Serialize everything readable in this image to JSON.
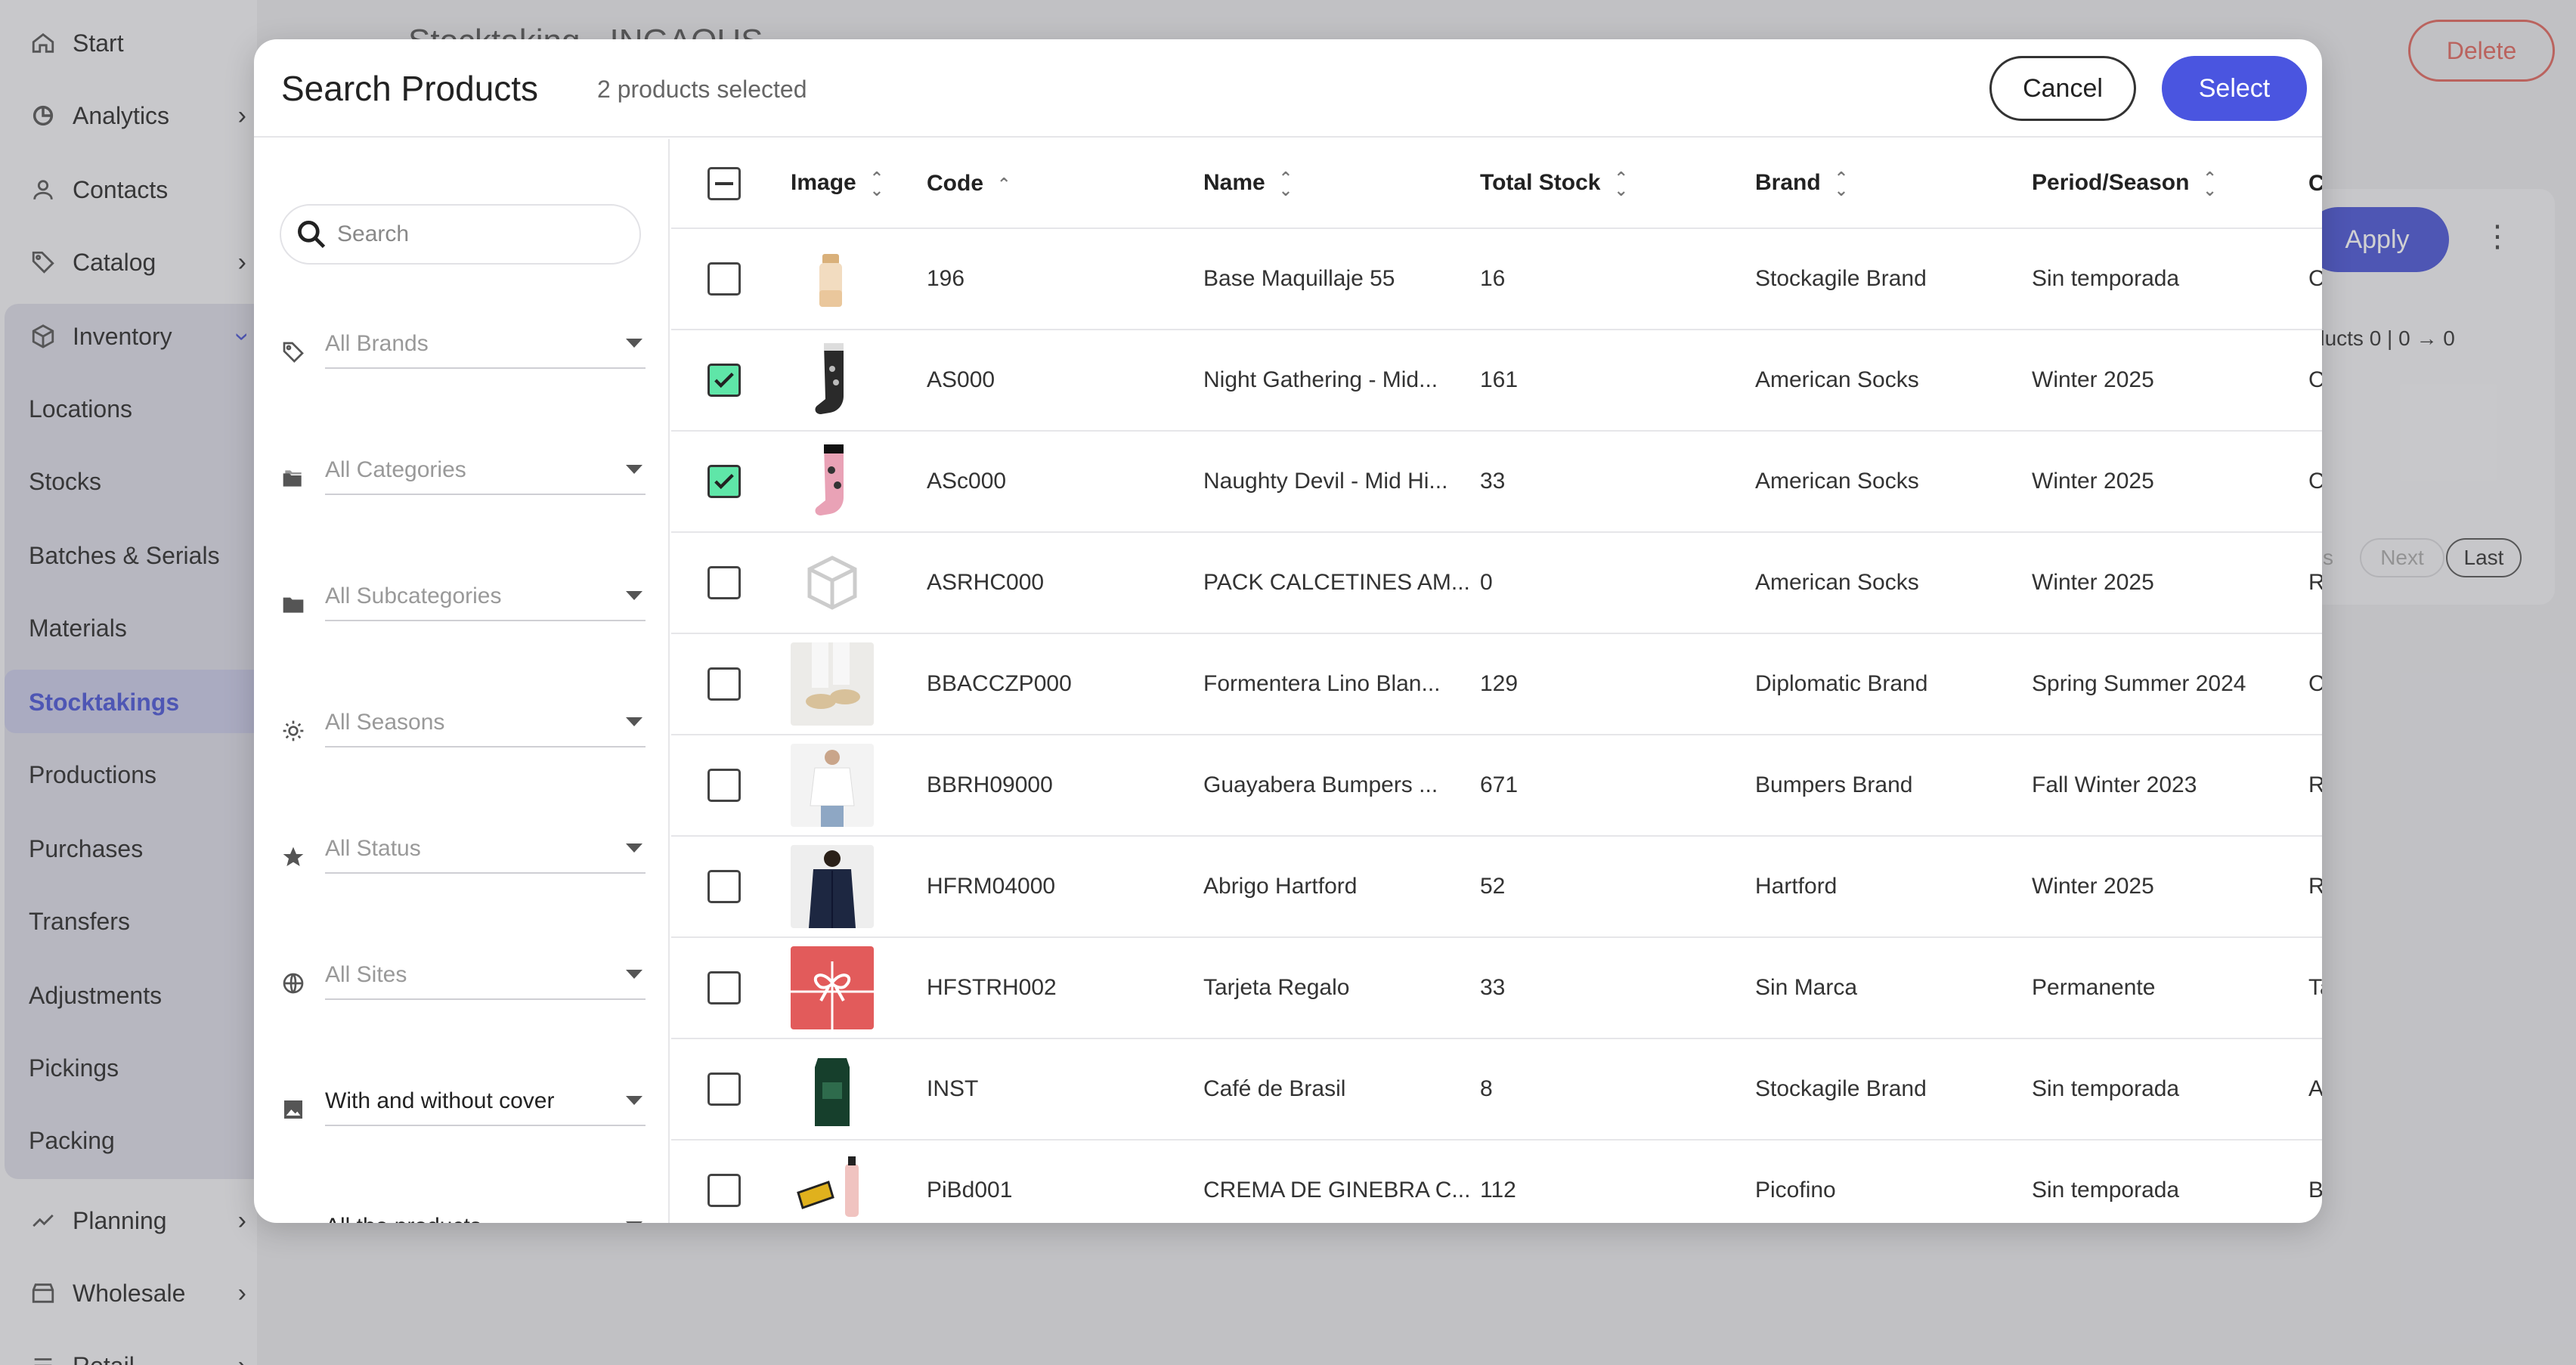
{
  "sidebar": {
    "items": [
      {
        "label": "Start",
        "icon": "home-icon",
        "chevron": false
      },
      {
        "label": "Analytics",
        "icon": "chart-icon",
        "chevron": true
      },
      {
        "label": "Contacts",
        "icon": "person-icon",
        "chevron": false
      },
      {
        "label": "Catalog",
        "icon": "tag-icon",
        "chevron": true
      },
      {
        "label": "Inventory",
        "icon": "box-icon",
        "chevron": true
      }
    ],
    "inventory_sub": [
      "Locations",
      "Stocks",
      "Batches & Serials",
      "Materials",
      "Stocktakings",
      "Productions",
      "Purchases",
      "Transfers",
      "Adjustments",
      "Pickings",
      "Packing"
    ],
    "active_item": "Stocktakings",
    "bottom_items": [
      {
        "label": "Planning",
        "icon": "trend-icon"
      },
      {
        "label": "Wholesale",
        "icon": "store-icon"
      },
      {
        "label": "Retail",
        "icon": "list-icon"
      }
    ]
  },
  "background": {
    "header_title": "Stocktaking · INGAQUS",
    "delete_label": "Delete",
    "apply_label": "Apply",
    "products_line": "ducts 0  | 0 → 0",
    "pager": {
      "prev": "s",
      "next": "Next",
      "last": "Last"
    }
  },
  "modal": {
    "title": "Search Products",
    "selected_count": "2 products selected",
    "cancel_label": "Cancel",
    "select_label": "Select",
    "search_placeholder": "Search",
    "filters": [
      {
        "label": "All Brands",
        "icon": "tag-icon",
        "filled": false
      },
      {
        "label": "All Categories",
        "icon": "folders-icon",
        "filled": false
      },
      {
        "label": "All Subcategories",
        "icon": "folder-icon",
        "filled": false
      },
      {
        "label": "All Seasons",
        "icon": "sun-icon",
        "filled": false
      },
      {
        "label": "All Status",
        "icon": "star-icon",
        "filled": false
      },
      {
        "label": "All Sites",
        "icon": "globe-icon",
        "filled": false
      },
      {
        "label": "With and without cover",
        "icon": "image-icon",
        "filled": true
      },
      {
        "label": "All the products",
        "icon": "checklist-icon",
        "filled": true
      }
    ],
    "columns": [
      "Image",
      "Code",
      "Name",
      "Total Stock",
      "Brand",
      "Period/Season",
      "C"
    ],
    "rows": [
      {
        "checked": false,
        "thumb": "cosmetic",
        "code": "196",
        "name": "Base Maquillaje 55",
        "stock": "16",
        "brand": "Stockagile Brand",
        "season": "Sin temporada",
        "extra": "C"
      },
      {
        "checked": true,
        "thumb": "sock-dark",
        "code": "AS000",
        "name": "Night Gathering - Mid...",
        "stock": "161",
        "brand": "American Socks",
        "season": "Winter 2025",
        "extra": "C"
      },
      {
        "checked": true,
        "thumb": "sock-pink",
        "code": "ASc000",
        "name": "Naughty Devil - Mid Hi...",
        "stock": "33",
        "brand": "American Socks",
        "season": "Winter 2025",
        "extra": "C"
      },
      {
        "checked": false,
        "thumb": "placeholder",
        "code": "ASRHC000",
        "name": "PACK CALCETINES AM...",
        "stock": "0",
        "brand": "American Socks",
        "season": "Winter 2025",
        "extra": "Ro"
      },
      {
        "checked": false,
        "thumb": "shoes",
        "code": "BBACCZP000",
        "name": "Formentera Lino Blan...",
        "stock": "129",
        "brand": "Diplomatic Brand",
        "season": "Spring Summer 2024",
        "extra": "C"
      },
      {
        "checked": false,
        "thumb": "shirt",
        "code": "BBRH09000",
        "name": "Guayabera Bumpers ...",
        "stock": "671",
        "brand": "Bumpers Brand",
        "season": "Fall Winter 2023",
        "extra": "Ro"
      },
      {
        "checked": false,
        "thumb": "coat",
        "code": "HFRM04000",
        "name": "Abrigo Hartford",
        "stock": "52",
        "brand": "Hartford",
        "season": "Winter 2025",
        "extra": "Ro"
      },
      {
        "checked": false,
        "thumb": "gift",
        "code": "HFSTRH002",
        "name": "Tarjeta Regalo",
        "stock": "33",
        "brand": "Sin Marca",
        "season": "Permanente",
        "extra": "Ta"
      },
      {
        "checked": false,
        "thumb": "coffee",
        "code": "INST",
        "name": "Café de Brasil",
        "stock": "8",
        "brand": "Stockagile Brand",
        "season": "Sin temporada",
        "extra": "Al"
      },
      {
        "checked": false,
        "thumb": "gin",
        "code": "PiBd001",
        "name": "CREMA DE GINEBRA C...",
        "stock": "112",
        "brand": "Picofino",
        "season": "Sin temporada",
        "extra": "Bo"
      }
    ]
  },
  "colors": {
    "accent": "#4a55e0",
    "check": "#5fe6a8",
    "danger": "#e0675f"
  }
}
